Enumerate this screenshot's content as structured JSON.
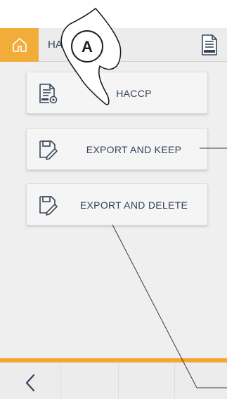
{
  "header": {
    "title": "HACCP",
    "home_icon": "home-icon",
    "doc_icon": "haccp-document-icon",
    "home_color": "#f2ac3a"
  },
  "menu": {
    "items": [
      {
        "label": "HACCP",
        "icon": "haccp-document-icon"
      },
      {
        "label": "EXPORT AND KEEP",
        "icon": "save-export-icon"
      },
      {
        "label": "EXPORT AND DELETE",
        "icon": "save-export-icon"
      }
    ]
  },
  "annotation": {
    "marker": "A"
  },
  "footer": {
    "back_icon": "chevron-left-icon",
    "accent": "#f5a62f"
  }
}
